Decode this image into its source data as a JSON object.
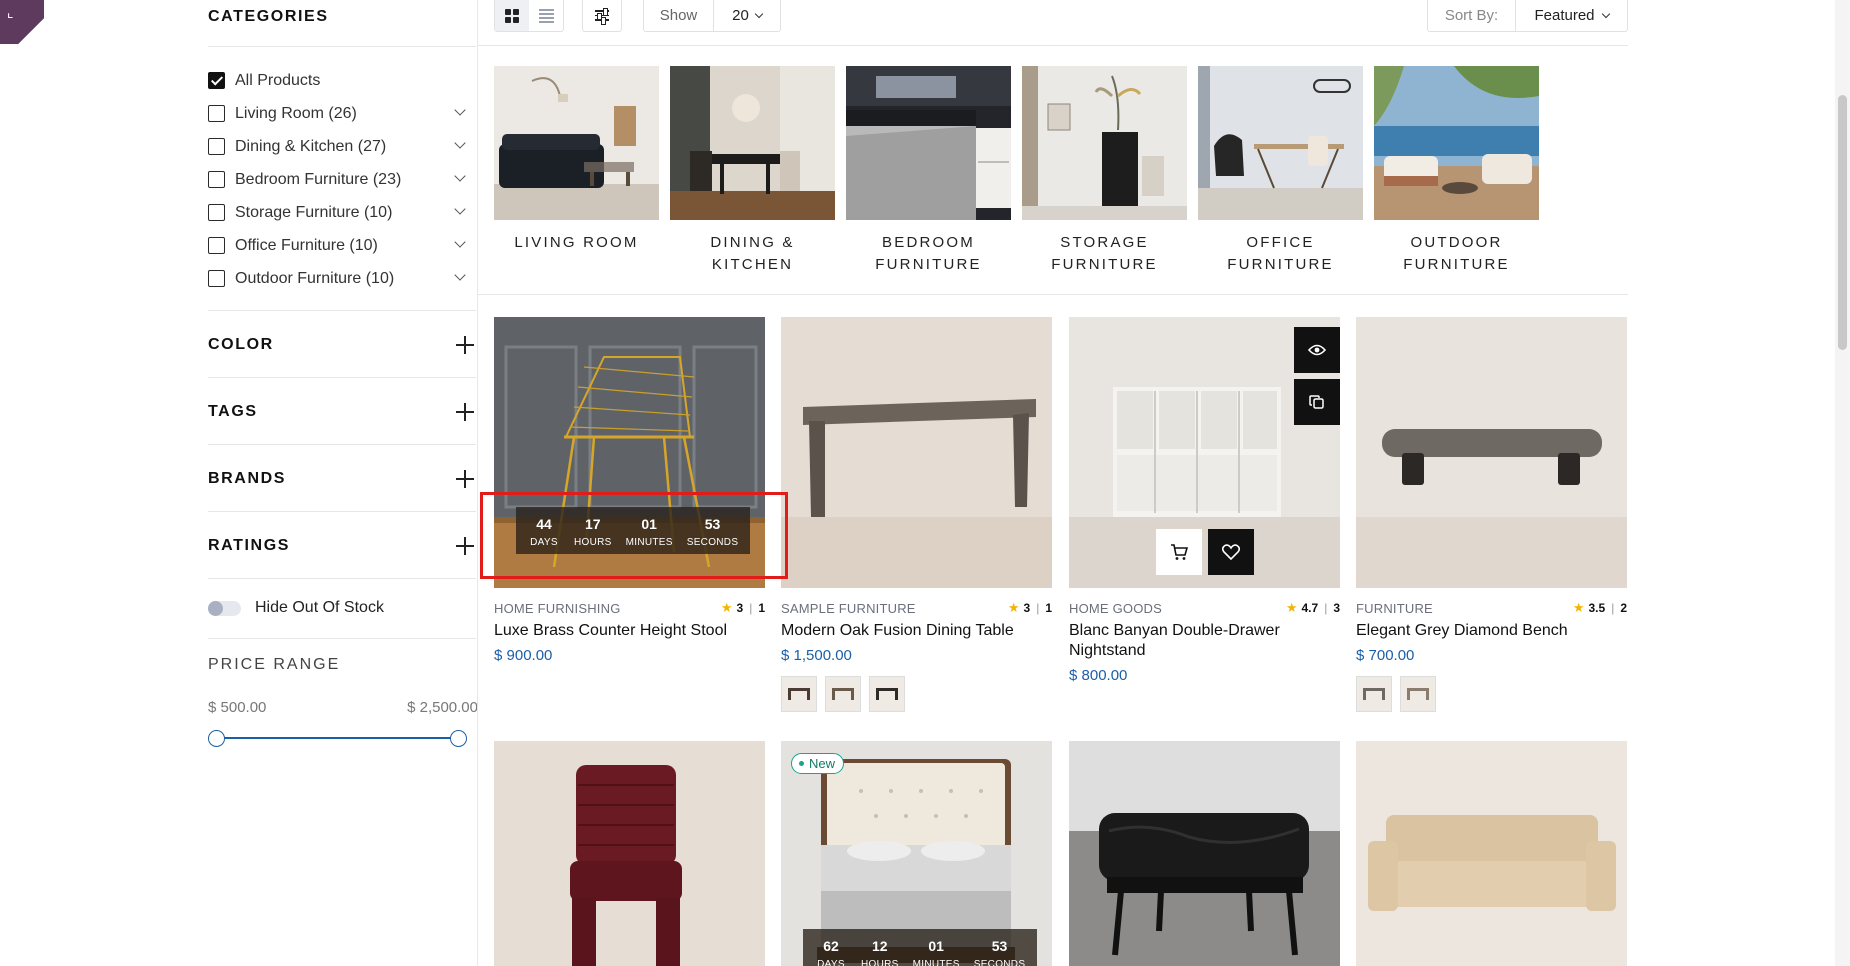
{
  "sidebar": {
    "categories_title": "CATEGORIES",
    "categories": [
      {
        "label": "All Products",
        "checked": true
      },
      {
        "label": "Living Room (26)",
        "checked": false
      },
      {
        "label": "Dining & Kitchen (27)",
        "checked": false
      },
      {
        "label": "Bedroom Furniture (23)",
        "checked": false
      },
      {
        "label": "Storage Furniture (10)",
        "checked": false
      },
      {
        "label": "Office Furniture (10)",
        "checked": false
      },
      {
        "label": "Outdoor Furniture (10)",
        "checked": false
      }
    ],
    "filters": [
      {
        "label": "COLOR"
      },
      {
        "label": "TAGS"
      },
      {
        "label": "BRANDS"
      },
      {
        "label": "RATINGS"
      }
    ],
    "hide_out_of_stock": "Hide Out Of Stock",
    "price_range": {
      "title": "PRICE RANGE",
      "min": "$ 500.00",
      "max": "$ 2,500.00"
    }
  },
  "toolbar": {
    "show_label": "Show",
    "show_value": "20",
    "sort_label": "Sort By:",
    "sort_value": "Featured"
  },
  "category_strip": [
    {
      "line1": "LIVING ROOM",
      "line2": ""
    },
    {
      "line1": "DINING & KITCHEN",
      "line2": ""
    },
    {
      "line1": "BEDROOM",
      "line2": "FURNITURE"
    },
    {
      "line1": "STORAGE",
      "line2": "FURNITURE"
    },
    {
      "line1": "OFFICE FURNITURE",
      "line2": ""
    },
    {
      "line1": "OUTDOOR",
      "line2": "FURNITURE"
    }
  ],
  "products": [
    {
      "category": "HOME FURNISHING",
      "rating": "3",
      "reviews": "1",
      "name": "Luxe Brass Counter Height Stool",
      "price": "$ 900.00",
      "countdown": {
        "days": "44",
        "hours": "17",
        "minutes": "01",
        "seconds": "53"
      }
    },
    {
      "category": "SAMPLE FURNITURE",
      "rating": "3",
      "reviews": "1",
      "name": "Modern Oak Fusion Dining Table",
      "price": "$ 1,500.00"
    },
    {
      "category": "HOME GOODS",
      "rating": "4.7",
      "reviews": "3",
      "name": "Blanc Banyan Double-Drawer Nightstand",
      "price": "$ 800.00"
    },
    {
      "category": "FURNITURE",
      "rating": "3.5",
      "reviews": "2",
      "name": "Elegant Grey Diamond Bench",
      "price": "$ 700.00"
    }
  ],
  "countdown_labels": {
    "days": "DAYS",
    "hours": "HOURS",
    "minutes": "MINUTES",
    "seconds": "SECONDS"
  },
  "second_row": {
    "badge": "New",
    "countdown": {
      "days": "62",
      "hours": "12",
      "minutes": "01",
      "seconds": "53"
    }
  },
  "colors": {
    "accent": "#1b5fa8",
    "highlight": "#e21b1b",
    "badge": "#1aa58a",
    "star": "#f4b400"
  }
}
